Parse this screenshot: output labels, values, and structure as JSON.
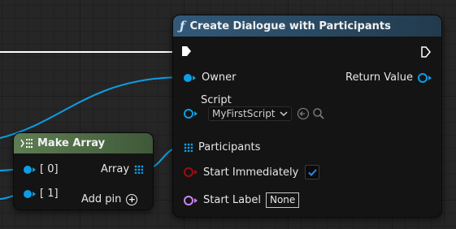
{
  "create_node": {
    "icon": "function-icon",
    "title": "Create Dialogue with Participants",
    "header_color": "#2a4a63",
    "owner_label": "Owner",
    "return_label": "Return Value",
    "script_label": "Script",
    "script_value": "MyFirstScript",
    "participants_label": "Participants",
    "start_immediately_label": "Start Immediately",
    "start_immediately_checked": true,
    "start_label_label": "Start Label",
    "start_label_value": "None"
  },
  "array_node": {
    "icon": "make-array-icon",
    "title": "Make Array",
    "header_color": "#56744a",
    "item0_label": "[ 0]",
    "item1_label": "[ 1]",
    "output_label": "Array",
    "add_pin_label": "Add pin"
  },
  "colors": {
    "exec": "#ffffff",
    "object": "#0d9de5",
    "boolean": "#9b0f13",
    "name": "#c987f3"
  }
}
